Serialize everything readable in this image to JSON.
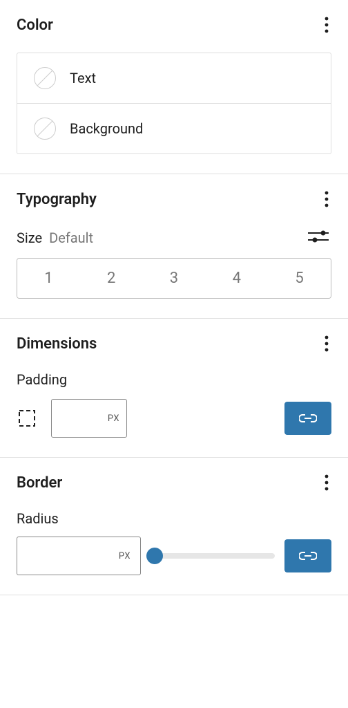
{
  "color": {
    "title": "Color",
    "items": [
      {
        "label": "Text"
      },
      {
        "label": "Background"
      }
    ]
  },
  "typography": {
    "title": "Typography",
    "size_label": "Size",
    "size_value": "Default",
    "steps": [
      "1",
      "2",
      "3",
      "4",
      "5"
    ]
  },
  "dimensions": {
    "title": "Dimensions",
    "padding_label": "Padding",
    "unit": "PX"
  },
  "border": {
    "title": "Border",
    "radius_label": "Radius",
    "unit": "PX"
  }
}
